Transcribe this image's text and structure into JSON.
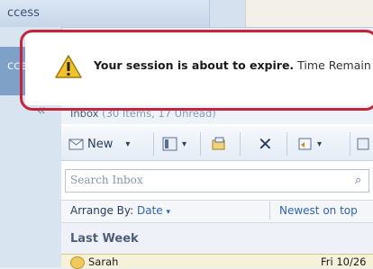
{
  "top": {
    "tab_label": "ccess"
  },
  "left_nav": {
    "collapsed_label": "ccess",
    "collapse_icon": "double-chevron-left-icon"
  },
  "banner": {
    "icon": "warning-icon",
    "title": "Your session is about to expire.",
    "subtitle": "Time Remain",
    "highlight_color": "#c3253b"
  },
  "inbox": {
    "title": "Inbox",
    "counts": "(30 Items, 17 Unread)"
  },
  "toolbar": {
    "new_label": "New",
    "icons": [
      "new-mail-icon",
      "view-icon",
      "move-folder-icon",
      "delete-icon",
      "reply-icon",
      "more-icon"
    ]
  },
  "search": {
    "placeholder": "Search Inbox"
  },
  "arrange": {
    "label": "Arrange By:",
    "value": "Date",
    "sort": "Newest on top"
  },
  "groups": [
    {
      "label": "Last Week",
      "items": [
        {
          "sender": "Sarah",
          "date": "Fri 10/26"
        }
      ]
    }
  ],
  "colors": {
    "accent": "#2e64b1",
    "warning": "#f2c229"
  }
}
